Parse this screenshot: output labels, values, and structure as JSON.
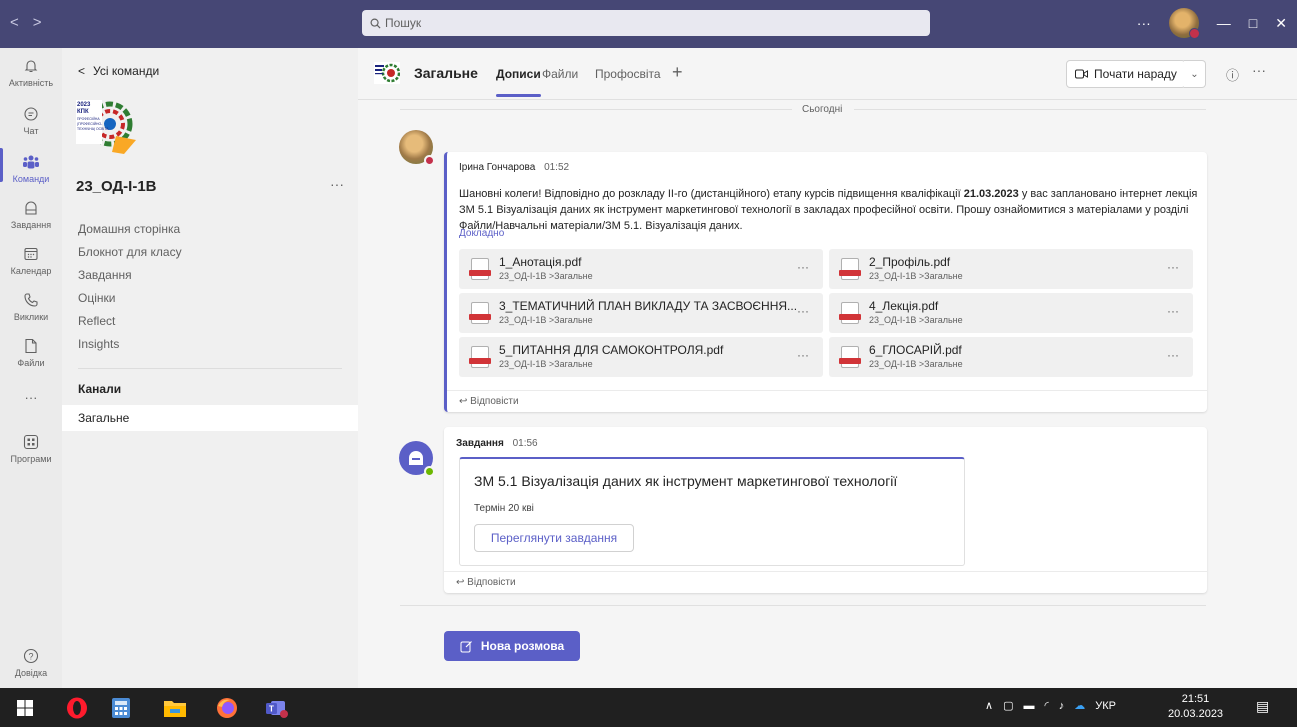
{
  "titlebar": {
    "back": "<",
    "forward": ">",
    "search_placeholder": "Пошук",
    "more": "···",
    "minimize": "—",
    "restore": "□",
    "close": "✕"
  },
  "rail": {
    "items": [
      {
        "label": "Активність",
        "icon": "bell-icon"
      },
      {
        "label": "Чат",
        "icon": "chat-icon"
      },
      {
        "label": "Команди",
        "icon": "teams-icon"
      },
      {
        "label": "Завдання",
        "icon": "assignments-icon"
      },
      {
        "label": "Календар",
        "icon": "calendar-icon"
      },
      {
        "label": "Виклики",
        "icon": "phone-icon"
      },
      {
        "label": "Файли",
        "icon": "file-icon"
      },
      {
        "label": "···",
        "icon": "more-icon"
      },
      {
        "label": "Програми",
        "icon": "apps-icon"
      },
      {
        "label": "Довідка",
        "icon": "help-icon"
      }
    ]
  },
  "team": {
    "back_label": "Усі команди",
    "logo_text": "2023 КПК ПРОФЕСІЙНА (ПРОФЕСІЙНО-ТЕХНІЧНА) ОСВІТА",
    "name": "23_ОД-І-1В",
    "more": "···",
    "links": [
      "Домашня сторінка",
      "Блокнот для класу",
      "Завдання",
      "Оцінки",
      "Reflect",
      "Insights"
    ],
    "channels_heading": "Канали",
    "active_channel": "Загальне"
  },
  "channel": {
    "title": "Загальне",
    "tabs": [
      "Дописи",
      "Файли",
      "Профосвіта"
    ],
    "add_tab": "+",
    "meet_label": "Почати нараду",
    "date_divider": "Сьогодні"
  },
  "post1": {
    "author": "Ірина Гончарова",
    "time": "01:52",
    "text_before": "Шановні колеги! Відповідно до розкладу ІІ-го (дистанційного) етапу курсів підвищення кваліфікації ",
    "text_bold": "21.03.2023",
    "text_after": " у вас заплановано інтернет лекція ЗМ 5.1 Візуалізація даних як інструмент маркетингової технології в закладах професійної освіти. Прошу ознайомитися з матеріалами у розділі Файли/Навчальні матеріали/ЗМ 5.1. Візуалізація даних.",
    "more_link": "Докладно",
    "files": [
      {
        "name": "1_Анотація.pdf",
        "path": "23_ОД-І-1В >Загальне"
      },
      {
        "name": "2_Профіль.pdf",
        "path": "23_ОД-І-1В >Загальне"
      },
      {
        "name": "3_ТЕМАТИЧНИЙ ПЛАН ВИКЛАДУ ТА ЗАСВОЄННЯ...",
        "path": "23_ОД-І-1В >Загальне"
      },
      {
        "name": "4_Лекція.pdf",
        "path": "23_ОД-І-1В >Загальне"
      },
      {
        "name": "5_ПИТАННЯ ДЛЯ САМОКОНТРОЛЯ.pdf",
        "path": "23_ОД-І-1В >Загальне"
      },
      {
        "name": "6_ГЛОСАРІЙ.pdf",
        "path": "23_ОД-І-1В >Загальне"
      }
    ],
    "reply": "Відповісти"
  },
  "post2": {
    "author": "Завдання",
    "time": "01:56",
    "task_title": "ЗМ 5.1 Візуалізація даних як інструмент маркетингової технології",
    "due": "Термін 20 кві",
    "view_button": "Переглянути завдання",
    "reply": "Відповісти"
  },
  "new_conversation": "Нова розмова",
  "taskbar": {
    "language": "УКР",
    "time": "21:51",
    "date": "20.03.2023"
  },
  "colors": {
    "accent": "#5b5fc7",
    "titlebar": "#464775",
    "taskbar": "#202020"
  }
}
